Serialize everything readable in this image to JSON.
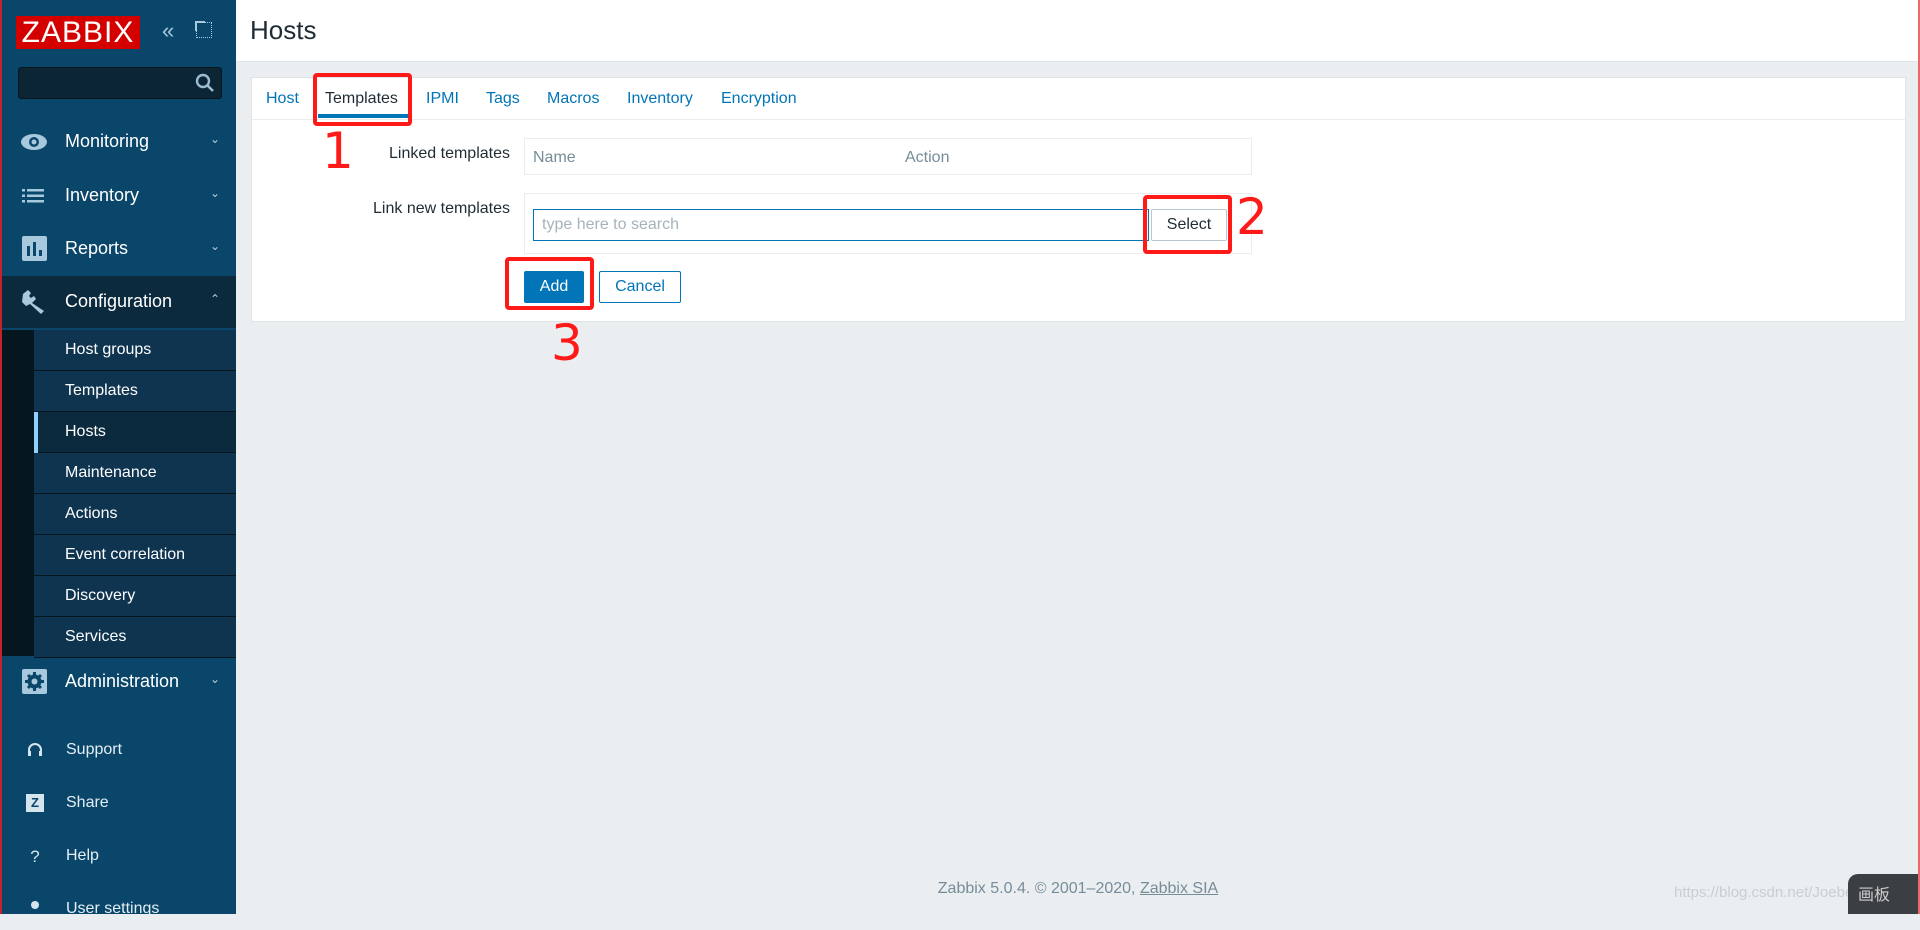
{
  "sidebar": {
    "logo": "ZABBIX",
    "search": {
      "value": "",
      "placeholder": ""
    },
    "menu": [
      {
        "label": "Monitoring",
        "icon": "eye-icon",
        "expanded": false
      },
      {
        "label": "Inventory",
        "icon": "list-icon",
        "expanded": false
      },
      {
        "label": "Reports",
        "icon": "bar-chart-icon",
        "expanded": false
      },
      {
        "label": "Configuration",
        "icon": "wrench-icon",
        "expanded": true
      },
      {
        "label": "Administration",
        "icon": "gear-icon",
        "expanded": false
      }
    ],
    "submenu": [
      {
        "label": "Host groups"
      },
      {
        "label": "Templates"
      },
      {
        "label": "Hosts",
        "active": true
      },
      {
        "label": "Maintenance"
      },
      {
        "label": "Actions"
      },
      {
        "label": "Event correlation"
      },
      {
        "label": "Discovery"
      },
      {
        "label": "Services"
      }
    ],
    "utility": [
      {
        "label": "Support",
        "icon": "headset-icon"
      },
      {
        "label": "Share",
        "icon": "share-z-icon",
        "glyph": "Z"
      },
      {
        "label": "Help",
        "icon": "help-icon",
        "glyph": "?"
      },
      {
        "label": "User settings",
        "icon": "user-icon"
      }
    ]
  },
  "header": {
    "title": "Hosts"
  },
  "tabs": [
    {
      "label": "Host"
    },
    {
      "label": "Templates",
      "active": true
    },
    {
      "label": "IPMI"
    },
    {
      "label": "Tags"
    },
    {
      "label": "Macros"
    },
    {
      "label": "Inventory"
    },
    {
      "label": "Encryption"
    }
  ],
  "form": {
    "linked_templates_label": "Linked templates",
    "linked_columns": [
      "Name",
      "Action"
    ],
    "link_new_label": "Link new templates",
    "search_placeholder": "type here to search",
    "search_value": "",
    "select_label": "Select",
    "add_label": "Add",
    "cancel_label": "Cancel"
  },
  "annotations": [
    "1",
    "2",
    "3"
  ],
  "footer": {
    "text": "Zabbix 5.0.4. © 2001–2020, ",
    "link": "Zabbix SIA"
  },
  "overlay": {
    "watermark": "https://blog.csdn.net/JoebeeT",
    "tool_label": "画板"
  },
  "colors": {
    "brand": "#d40000",
    "accent": "#0275b8",
    "sidebar": "#0a466a",
    "annotation": "#ff1a1a"
  }
}
